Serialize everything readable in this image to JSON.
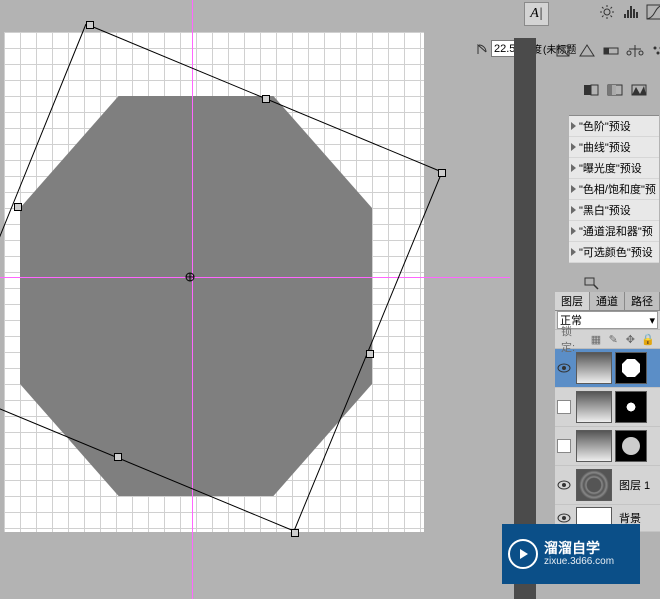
{
  "toolbar": {
    "type_tool": "A|"
  },
  "rotate": {
    "value": "22.5",
    "unit": "度",
    "label": "(未标题"
  },
  "presets": {
    "items": [
      "\"色阶\"预设",
      "\"曲线\"预设",
      "\"曝光度\"预设",
      "\"色相/饱和度\"预",
      "\"黑白\"预设",
      "\"通道混和器\"预",
      "\"可选颜色\"预设"
    ]
  },
  "layers_panel": {
    "tabs": [
      "图层",
      "通道",
      "路径"
    ],
    "blend_mode": "正常",
    "lock_label": "锁定:",
    "layers": [
      {
        "name": ""
      },
      {
        "name": ""
      },
      {
        "name": ""
      },
      {
        "name": "图层 1"
      },
      {
        "name": "背景"
      }
    ]
  },
  "watermark": {
    "cn": "溜溜自学",
    "url": "zixue.3d66.com"
  }
}
